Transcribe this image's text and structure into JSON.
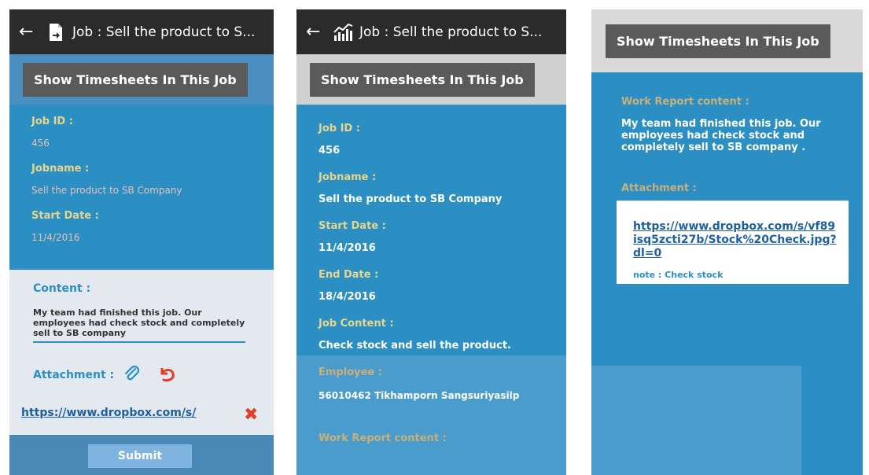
{
  "panel1": {
    "title": "Job : Sell the product to S...",
    "show_button": "Show Timesheets In This Job",
    "job_id_label": "Job ID :",
    "job_id": "456",
    "jobname_label": "Jobname :",
    "jobname": "Sell the product to SB Company",
    "start_label": "Start Date :",
    "start_date": "11/4/2016",
    "content_label": "Content :",
    "content_text": "My team had finished this job. Our employees had check stock and completely sell to SB company",
    "attachment_label": "Attachment :",
    "attachment_link": "https://www.dropbox.com/s/",
    "submit_label": "Submit"
  },
  "panel2": {
    "title": "Job : Sell the product to S...",
    "show_button": "Show Timesheets In This Job",
    "job_id_label": "Job ID :",
    "job_id": "456",
    "jobname_label": "Jobname :",
    "jobname": "Sell the product to SB Company",
    "start_label": "Start Date :",
    "start_date": "11/4/2016",
    "end_label": "End Date :",
    "end_date": "18/4/2016",
    "job_content_label": "Job Content :",
    "job_content": "Check stock and sell the product.",
    "employee_label": "Employee :",
    "employee": "56010462 Tikhamporn Sangsuriyasilp",
    "work_report_label": "Work Report content :"
  },
  "panel3": {
    "show_button": "Show Timesheets In This Job",
    "work_report_label": "Work Report content :",
    "work_report": "My team had finished this job. Our employees had check stock and completely sell to SB company .",
    "attachment_label": "Attachment :",
    "attachment_link": "https://www.dropbox.com/s/vf89isq5zcti27b/Stock%20Check.jpg?dl=0",
    "note": "note : Check stock"
  },
  "colors": {
    "primary_blue": "#2c8fc4",
    "dark_bar": "#2b2b2b",
    "button_gray": "#5a5a5a",
    "label_gold": "#e6d58a",
    "delete_red": "#e0402a"
  }
}
